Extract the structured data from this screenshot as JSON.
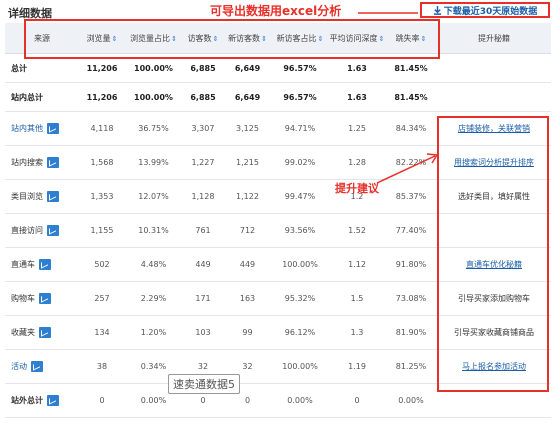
{
  "title": "详细数据",
  "export_note": "可导出数据用excel分析",
  "download_button": "下载最近30天原始数据",
  "advice_label": "提升建议",
  "watermark": "速卖通数据5",
  "columns": [
    "来源",
    "浏览量",
    "浏览量占比",
    "访客数",
    "新访客数",
    "新访客占比",
    "平均访问深度",
    "跳失率",
    "提升秘籍"
  ],
  "sortable_columns": [
    1,
    2,
    3,
    4,
    5,
    6,
    7
  ],
  "rows": [
    {
      "source": "总计",
      "values": [
        "11,206",
        "100.00%",
        "6,885",
        "6,649",
        "96.57%",
        "1.63",
        "81.45%"
      ],
      "advice": "",
      "kind": "total"
    },
    {
      "source": "站内总计",
      "values": [
        "11,206",
        "100.00%",
        "6,885",
        "6,649",
        "96.57%",
        "1.63",
        "81.45%"
      ],
      "advice": "",
      "kind": "subtotal"
    },
    {
      "source": "站内其他",
      "values": [
        "4,118",
        "36.75%",
        "3,307",
        "3,125",
        "94.71%",
        "1.25",
        "84.34%"
      ],
      "advice": "店铺装修，关联营销",
      "kind": "link"
    },
    {
      "source": "站内搜索",
      "values": [
        "1,568",
        "13.99%",
        "1,227",
        "1,215",
        "99.02%",
        "1.28",
        "82.22%"
      ],
      "advice": "用搜索词分析提升排序",
      "kind": "normal"
    },
    {
      "source": "类目浏览",
      "values": [
        "1,353",
        "12.07%",
        "1,128",
        "1,122",
        "99.47%",
        "1.2",
        "85.37%"
      ],
      "advice": "选好类目，填好属性",
      "kind": "normal"
    },
    {
      "source": "直接访问",
      "values": [
        "1,155",
        "10.31%",
        "761",
        "712",
        "93.56%",
        "1.52",
        "77.40%"
      ],
      "advice": "",
      "kind": "normal"
    },
    {
      "source": "直通车",
      "values": [
        "502",
        "4.48%",
        "449",
        "449",
        "100.00%",
        "1.12",
        "91.80%"
      ],
      "advice": "直通车优化秘籍",
      "kind": "normal"
    },
    {
      "source": "购物车",
      "values": [
        "257",
        "2.29%",
        "171",
        "163",
        "95.32%",
        "1.5",
        "73.08%"
      ],
      "advice": "引导买家添加购物车",
      "kind": "normal"
    },
    {
      "source": "收藏夹",
      "values": [
        "134",
        "1.20%",
        "103",
        "99",
        "96.12%",
        "1.3",
        "81.90%"
      ],
      "advice": "引导买家收藏商铺商品",
      "kind": "normal"
    },
    {
      "source": "活动",
      "values": [
        "38",
        "0.34%",
        "32",
        "32",
        "100.00%",
        "1.19",
        "81.25%"
      ],
      "advice": "马上报名参加活动",
      "kind": "link"
    },
    {
      "source": "站外总计",
      "values": [
        "0",
        "0.00%",
        "0",
        "0",
        "0.00%",
        "0",
        "0.00%"
      ],
      "advice": "",
      "kind": "bold"
    }
  ],
  "link_advice": [
    0,
    1,
    4,
    7
  ],
  "colors": {
    "accent_red": "#e8302a",
    "link_blue": "#1a5ea8",
    "icon_blue": "#2f7fd1",
    "header_bg": "#eef1f6"
  }
}
